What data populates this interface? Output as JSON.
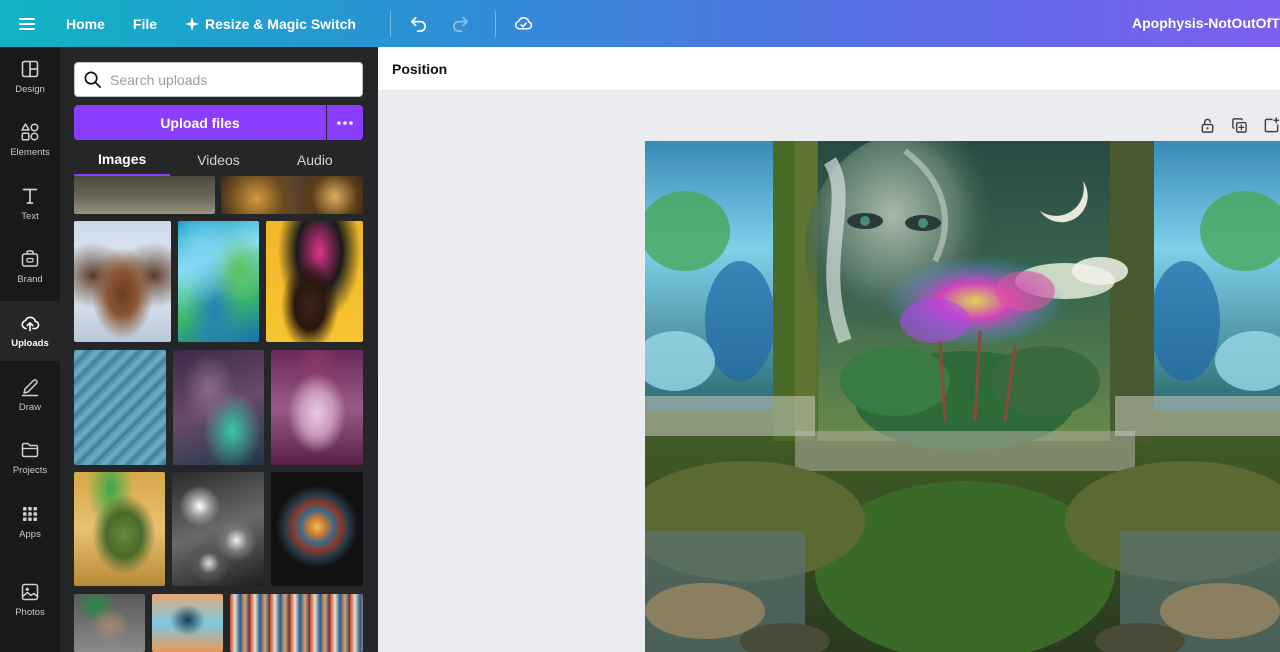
{
  "topbar": {
    "menu_icon": "hamburger-icon",
    "home_label": "Home",
    "file_label": "File",
    "resize_label": "Resize & Magic Switch",
    "resize_icon": "sparkle-icon",
    "undo_icon": "undo-icon",
    "redo_icon": "redo-icon",
    "save_status_icon": "cloud-check-icon",
    "doc_title": "Apophysis-NotOutOfThe"
  },
  "rail": {
    "items": [
      {
        "label": "Design",
        "icon": "layout-icon"
      },
      {
        "label": "Elements",
        "icon": "shapes-icon"
      },
      {
        "label": "Text",
        "icon": "text-icon"
      },
      {
        "label": "Brand",
        "icon": "brand-icon"
      },
      {
        "label": "Uploads",
        "icon": "cloud-upload-icon",
        "active": true
      },
      {
        "label": "Draw",
        "icon": "pen-icon"
      },
      {
        "label": "Projects",
        "icon": "folder-icon"
      },
      {
        "label": "Apps",
        "icon": "apps-grid-icon"
      },
      {
        "label": "Photos",
        "icon": "image-icon"
      }
    ]
  },
  "panel": {
    "search_placeholder": "Search uploads",
    "upload_label": "Upload files",
    "tabs": [
      {
        "label": "Images",
        "active": true
      },
      {
        "label": "Videos"
      },
      {
        "label": "Audio"
      }
    ]
  },
  "context_bar": {
    "position_label": "Position"
  },
  "canvas": {
    "page_tools": [
      "lock-icon",
      "duplicate-icon",
      "add-page-icon"
    ]
  },
  "colors": {
    "accent": "#8b3dff",
    "rail_bg": "#18191b",
    "panel_bg": "#252627",
    "canvas_bg": "#ebecf0"
  }
}
